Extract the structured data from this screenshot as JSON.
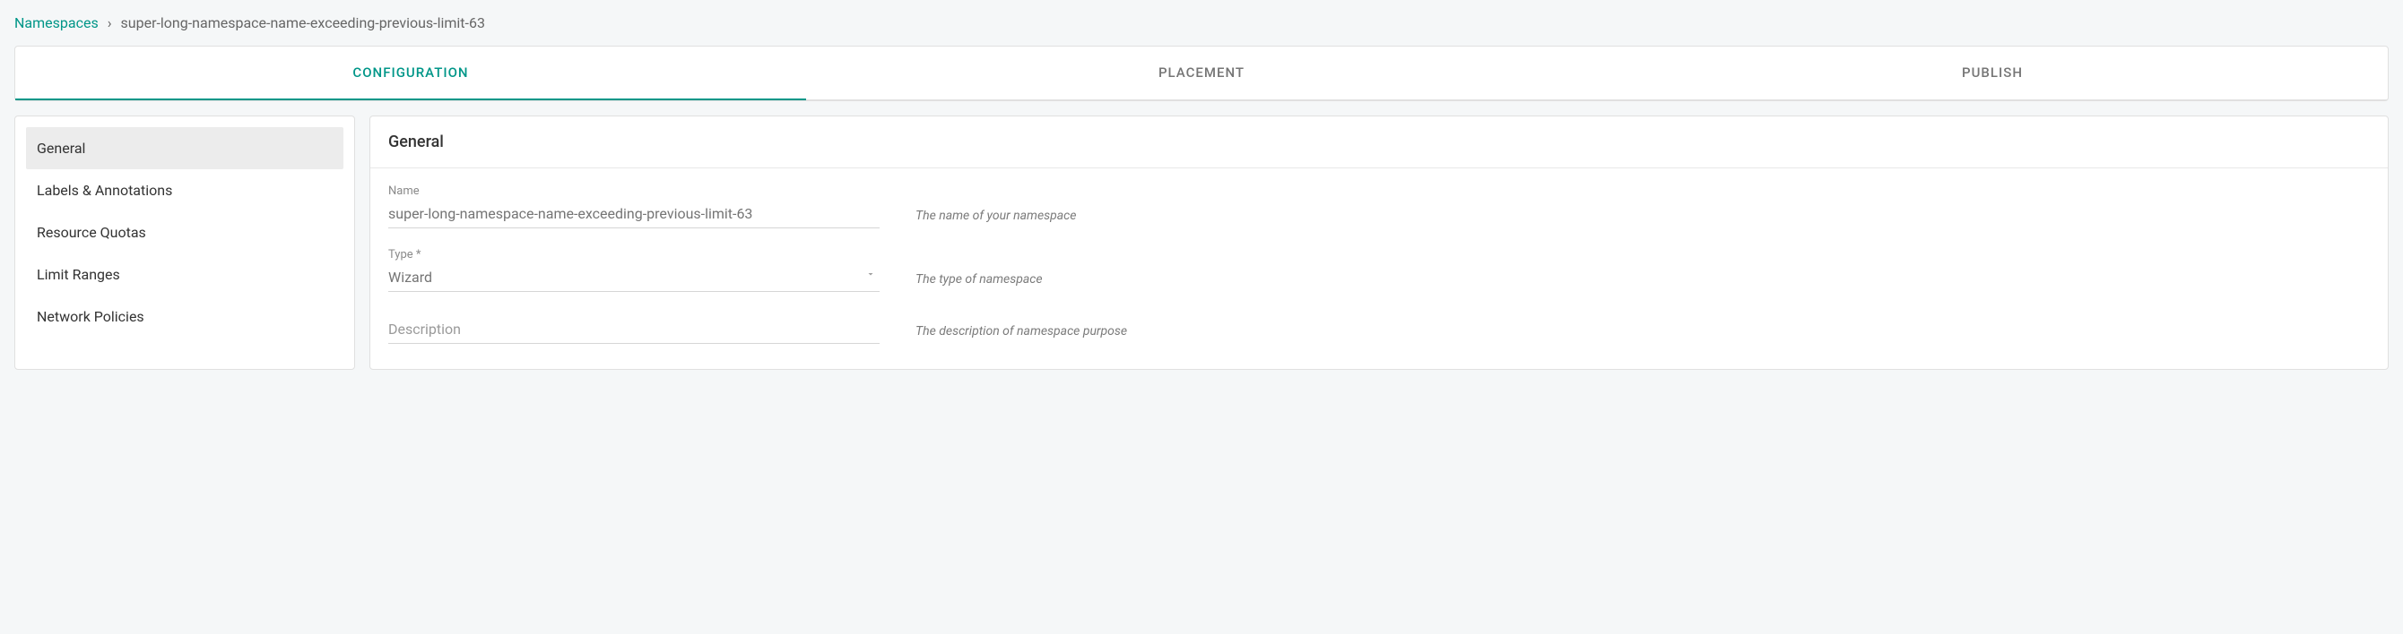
{
  "breadcrumb": {
    "root": "Namespaces",
    "separator": "›",
    "current": "super-long-namespace-name-exceeding-previous-limit-63"
  },
  "tabs": {
    "items": [
      {
        "label": "CONFIGURATION",
        "active": true
      },
      {
        "label": "PLACEMENT",
        "active": false
      },
      {
        "label": "PUBLISH",
        "active": false
      }
    ]
  },
  "sidebar": {
    "items": [
      {
        "label": "General",
        "active": true
      },
      {
        "label": "Labels & Annotations",
        "active": false
      },
      {
        "label": "Resource Quotas",
        "active": false
      },
      {
        "label": "Limit Ranges",
        "active": false
      },
      {
        "label": "Network Policies",
        "active": false
      }
    ]
  },
  "panel": {
    "title": "General",
    "fields": {
      "name": {
        "label": "Name",
        "value": "super-long-namespace-name-exceeding-previous-limit-63",
        "hint": "The name of your namespace"
      },
      "type": {
        "label": "Type *",
        "value": "Wizard",
        "hint": "The type of namespace"
      },
      "description": {
        "placeholder": "Description",
        "hint": "The description of namespace purpose"
      }
    }
  }
}
